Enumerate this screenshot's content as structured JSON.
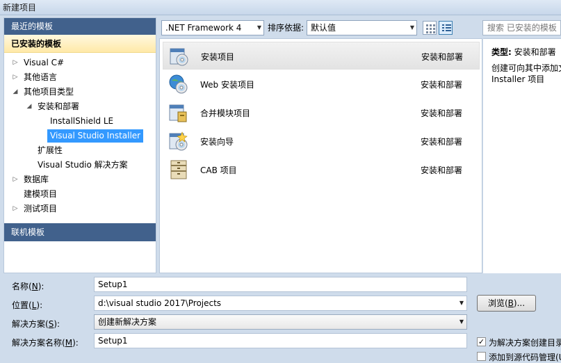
{
  "window": {
    "title": "新建项目"
  },
  "left": {
    "recent_header": "最近的模板",
    "installed_header": "已安装的模板",
    "online_header": "联机模板",
    "tree": [
      {
        "label": "Visual C#",
        "level": 0,
        "arrow": "collapsed"
      },
      {
        "label": "其他语言",
        "level": 0,
        "arrow": "collapsed"
      },
      {
        "label": "其他项目类型",
        "level": 0,
        "arrow": "expanded"
      },
      {
        "label": "安装和部署",
        "level": 1,
        "arrow": "expanded"
      },
      {
        "label": "InstallShield LE",
        "level": 2,
        "arrow": "none"
      },
      {
        "label": "Visual Studio Installer",
        "level": 2,
        "arrow": "none",
        "selected": true
      },
      {
        "label": "扩展性",
        "level": 1,
        "arrow": "none"
      },
      {
        "label": "Visual Studio 解决方案",
        "level": 1,
        "arrow": "none"
      },
      {
        "label": "数据库",
        "level": 0,
        "arrow": "collapsed"
      },
      {
        "label": "建模项目",
        "level": 0,
        "arrow": "none"
      },
      {
        "label": "测试项目",
        "level": 0,
        "arrow": "collapsed"
      }
    ]
  },
  "toolbar": {
    "framework": ".NET Framework 4",
    "sort_label": "排序依据:",
    "sort_value": "默认值",
    "search_placeholder": "搜索 已安装的模板"
  },
  "templates": [
    {
      "name": "安装项目",
      "category": "安装和部署",
      "icon": "setup-project-icon",
      "selected": true
    },
    {
      "name": "Web 安装项目",
      "category": "安装和部署",
      "icon": "web-setup-project-icon"
    },
    {
      "name": "合并模块项目",
      "category": "安装和部署",
      "icon": "merge-module-icon"
    },
    {
      "name": "安装向导",
      "category": "安装和部署",
      "icon": "setup-wizard-icon"
    },
    {
      "name": "CAB 项目",
      "category": "安装和部署",
      "icon": "cab-project-icon"
    }
  ],
  "details": {
    "type_label": "类型:",
    "type_value": "安装和部署",
    "desc_line1": "创建可向其中添加文",
    "desc_line2": "Installer 项目"
  },
  "form": {
    "name_label": "名称",
    "name_key": "N",
    "name_value": "Setup1",
    "location_label": "位置",
    "location_key": "L",
    "location_value": "d:\\visual studio 2017\\Projects",
    "solution_label": "解决方案",
    "solution_key": "S",
    "solution_value": "创建新解决方案",
    "solution_name_label": "解决方案名称",
    "solution_name_key": "M",
    "solution_name_value": "Setup1",
    "browse_label": "浏览",
    "browse_key": "B",
    "create_dir_label": "为解决方案创建目录",
    "create_dir_checked": true,
    "source_control_label": "添加到源代码管理(U)",
    "source_control_checked": false
  }
}
